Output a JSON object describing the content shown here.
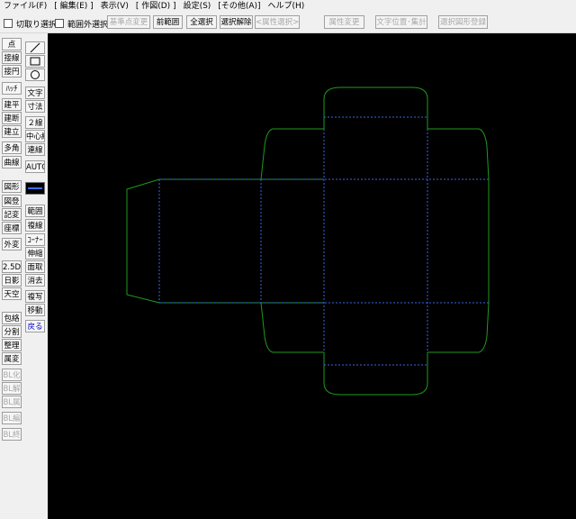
{
  "menu": [
    "ファイル(F)",
    "[ 編集(E) ]",
    "表示(V)",
    "[ 作図(D) ]",
    "設定(S)",
    "[その他(A)]",
    "ヘルプ(H)"
  ],
  "toolbar": {
    "check_cut": "切取り選択",
    "check_outside": "範囲外選択",
    "base_point": "基準点変更",
    "prev_range": "前範囲",
    "select_all": "全選択",
    "deselect": "選択解除",
    "attr_select": "<属性選択>",
    "attr_change": "属性変更",
    "text_pos": "文字位置･集計",
    "register_shape": "選択図形登録"
  },
  "left_col": [
    "点",
    "接線",
    "接円",
    "ﾊｯﾁ",
    "建平",
    "建断",
    "建立",
    "多角",
    "曲線",
    "図形",
    "図登",
    "記変",
    "座標",
    "外変",
    "2.5D",
    "日影",
    "天空",
    "包絡",
    "分割",
    "整理",
    "属変",
    "BL化",
    "BL解",
    "BL属",
    "BL編",
    "BL終"
  ],
  "right_col": [
    "文字",
    "寸法",
    "２線",
    "中心線",
    "連線",
    "AUTO",
    "範囲",
    "複線",
    "ｺｰﾅｰ",
    "伸縮",
    "面取",
    "消去",
    "複写",
    "移動",
    "戻る"
  ],
  "right_icons": [
    "line-icon",
    "rectangle-icon",
    "circle-icon"
  ],
  "colors": {
    "canvas": "#000000",
    "outline": "#1f9a1f",
    "fold": "#3a66e0"
  }
}
